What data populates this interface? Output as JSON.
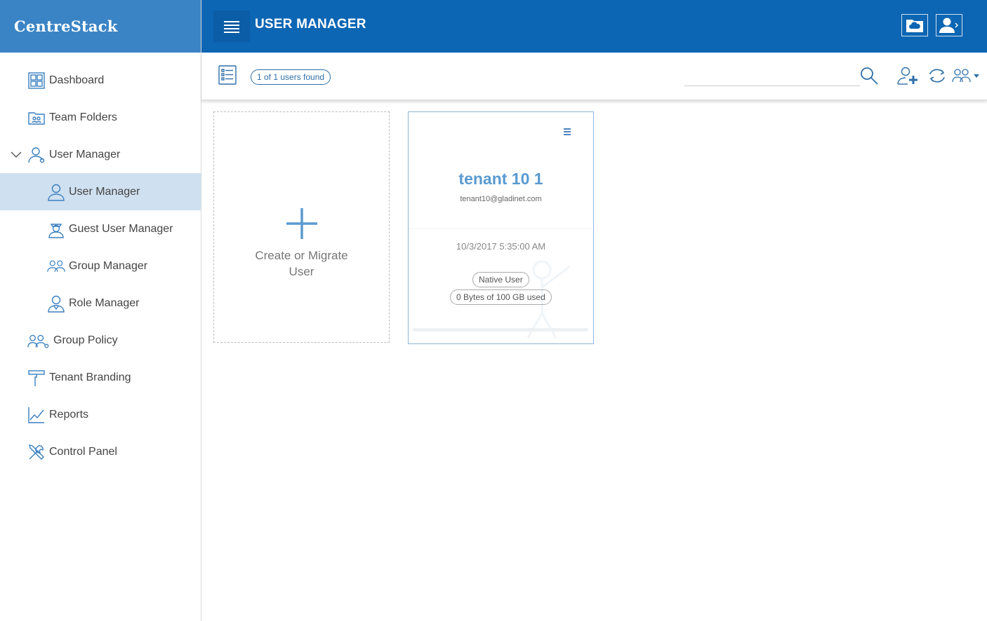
{
  "brand": {
    "name": "CentreStack"
  },
  "header": {
    "title": "USER MANAGER",
    "icons": [
      "menu-icon",
      "cloud-folder-icon",
      "user-profile-icon"
    ]
  },
  "sidebar": {
    "items": [
      {
        "label": "Dashboard",
        "icon": "dashboard-icon",
        "level": 1
      },
      {
        "label": "Team Folders",
        "icon": "team-folders-icon",
        "level": 1
      },
      {
        "label": "User Manager",
        "icon": "user-manager-icon",
        "level": 1,
        "expanded": true
      },
      {
        "label": "User Manager",
        "icon": "user-icon",
        "level": 2,
        "active": true
      },
      {
        "label": "Guest User Manager",
        "icon": "guest-user-icon",
        "level": 2
      },
      {
        "label": "Group Manager",
        "icon": "group-icon",
        "level": 2
      },
      {
        "label": "Role Manager",
        "icon": "role-icon",
        "level": 2
      },
      {
        "label": "Group Policy",
        "icon": "group-policy-icon",
        "level": 1
      },
      {
        "label": "Tenant Branding",
        "icon": "paint-roller-icon",
        "level": 1
      },
      {
        "label": "Reports",
        "icon": "chart-icon",
        "level": 1
      },
      {
        "label": "Control Panel",
        "icon": "tools-icon",
        "level": 1
      }
    ]
  },
  "toolbar": {
    "count_label": "1 of 1 users found",
    "search_value": "",
    "search_placeholder": "",
    "icons": [
      "list-view-icon",
      "search-icon",
      "add-user-icon",
      "sync-icon",
      "group-dropdown-icon"
    ]
  },
  "create_card": {
    "label": "Create or Migrate User"
  },
  "users": [
    {
      "name": "tenant 10 1",
      "email": "tenant10@gladinet.com",
      "date": "10/3/2017 5:35:00 AM",
      "type": "Native User",
      "storage": "0 Bytes of 100 GB used",
      "storage_fraction": 0.0
    }
  ],
  "colors": {
    "brand_bg": "#3a84c5",
    "header_bg": "#0c66b4",
    "active_nav": "#cfe0f0",
    "accent": "#5a9ad0"
  }
}
